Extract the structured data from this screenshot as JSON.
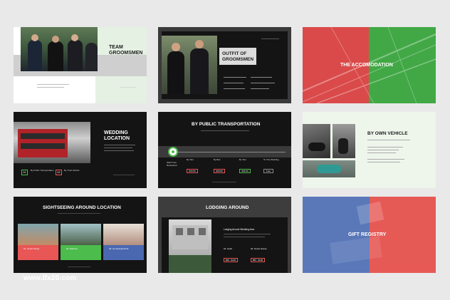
{
  "slides": {
    "team_groomsmen": {
      "title_line1": "TEAM",
      "title_line2": "GROOMSMEN"
    },
    "outfit_groomsmen": {
      "title_line1": "OUTFIT OF",
      "title_line2": "GROOMSMEN"
    },
    "accomodation": {
      "title": "THE ACCOMODATION"
    },
    "wedding_location": {
      "title_line1": "WEDDING",
      "title_line2": "LOCATION",
      "item1_num": "01",
      "item1_label": "By Public Transportation",
      "item2_num": "02",
      "item2_label": "By Trust Vehicle"
    },
    "public_transport": {
      "title": "BY PUBLIC TRANSPORTATION",
      "start_label": "Start From",
      "start_sub": "Restaurant",
      "stops": [
        {
          "label": "By Taxi",
          "price": "$15.00"
        },
        {
          "label": "By Bus",
          "price": "$25.00"
        },
        {
          "label": "By Taxi",
          "price": "$35.00"
        },
        {
          "label": "To The Wedding",
          "price": "Free"
        }
      ]
    },
    "own_vehicle": {
      "title": "BY OWN VEHICLE"
    },
    "sightseeing": {
      "title": "SIGHTSEEING AROUND LOCATION",
      "cards": [
        {
          "label": "01. Great Outing",
          "color": "#e85656"
        },
        {
          "label": "02. Eateries",
          "color": "#4cbc4c"
        },
        {
          "label": "03. Homestead Park",
          "color": "#4a68b0"
        }
      ]
    },
    "lodging": {
      "title": "LODGING AROUND",
      "subtitle": "Lodging Around Wedding Area",
      "hotel1": "01. Hotel",
      "hotel2": "02. Guest House",
      "price1": "$99 - $120",
      "price2": "$50 - $100"
    },
    "gift_registry": {
      "title": "GIFT REGISTRY"
    }
  },
  "watermark": "www.lfx20.com",
  "colors": {
    "green": "#4cbc4c",
    "red": "#e85656",
    "blue": "#4a68b0",
    "dark": "#141414"
  }
}
